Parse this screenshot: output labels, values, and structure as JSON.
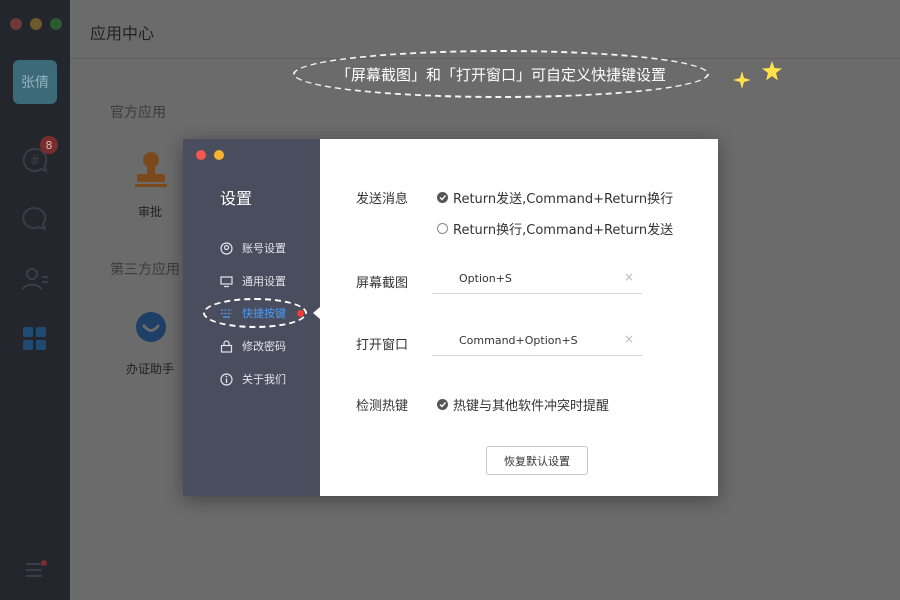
{
  "app": {
    "title": "应用中心",
    "user_avatar_text": "张倩",
    "unread_badge": "8"
  },
  "sections": {
    "official_apps": "官方应用",
    "third_party_apps": "第三方应用"
  },
  "apps": {
    "approval": "审批",
    "zhengjian_helper": "办证助手"
  },
  "annotation": {
    "text": "「屏幕截图」和「打开窗口」可自定义快捷键设置"
  },
  "settings": {
    "title": "设置",
    "nav": [
      {
        "label": "账号设置",
        "icon": "account-icon"
      },
      {
        "label": "通用设置",
        "icon": "monitor-icon"
      },
      {
        "label": "快捷按键",
        "icon": "shortcut-icon"
      },
      {
        "label": "修改密码",
        "icon": "lock-icon"
      },
      {
        "label": "关于我们",
        "icon": "info-icon"
      }
    ],
    "active_nav": "快捷按键",
    "send_message": {
      "label": "发送消息",
      "options": [
        {
          "text": "Return发送,Command+Return换行",
          "selected": true
        },
        {
          "text": "Return换行,Command+Return发送",
          "selected": false
        }
      ]
    },
    "screenshot": {
      "label": "屏幕截图",
      "value": "Option+S",
      "clear": "×"
    },
    "open_window": {
      "label": "打开窗口",
      "value": "Command+Option+S",
      "clear": "×"
    },
    "hotkey_check": {
      "label": "检测热键",
      "option": "热键与其他软件冲突时提醒",
      "checked": true
    },
    "reset_button": "恢复默认设置"
  },
  "colors": {
    "accent": "#4d9df4",
    "sidebar": "#4a4d5e",
    "alert": "#f03a3a",
    "highlight": "#ffe24a"
  }
}
